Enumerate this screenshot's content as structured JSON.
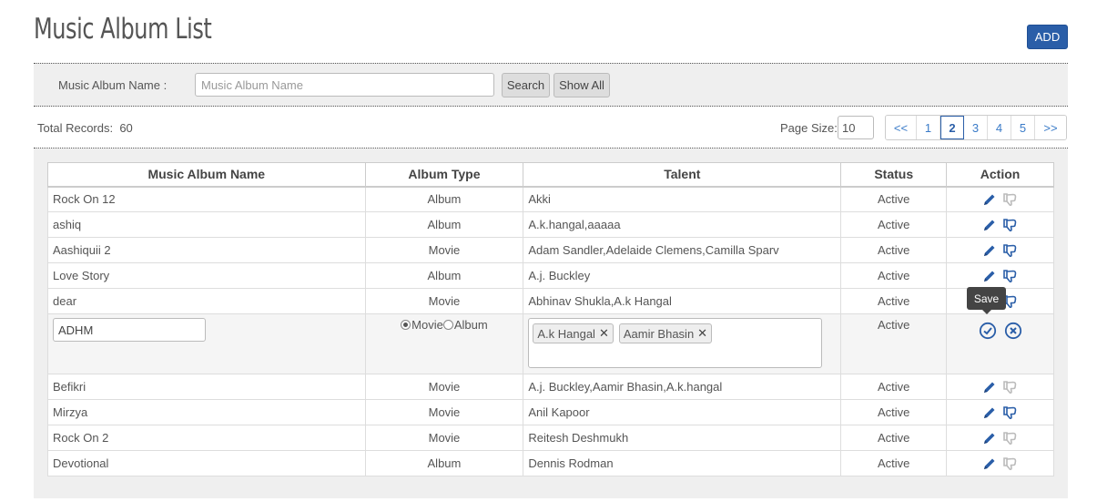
{
  "header": {
    "title": "Music Album List",
    "add_label": "ADD"
  },
  "search": {
    "label": "Music Album Name :",
    "placeholder": "Music Album Name",
    "search_label": "Search",
    "show_all_label": "Show All"
  },
  "records": {
    "total_label": "Total Records:",
    "total_value": "60",
    "page_size_label": "Page Size:",
    "page_size_value": "10"
  },
  "pager": [
    {
      "label": "<<",
      "w": 34
    },
    {
      "label": "1",
      "w": 26
    },
    {
      "label": "2",
      "w": 26
    },
    {
      "label": "3",
      "w": 26
    },
    {
      "label": "4",
      "w": 26
    },
    {
      "label": "5",
      "w": 26
    },
    {
      "label": ">>",
      "w": 34
    }
  ],
  "current_page": "2",
  "table": {
    "headers": [
      "Music Album Name",
      "Album Type",
      "Talent",
      "Status",
      "Action"
    ],
    "rows_before": [
      {
        "name": "Rock On 12",
        "type": "Album",
        "talent": "Akki",
        "status": "Active",
        "like_active": false
      },
      {
        "name": "ashiq",
        "type": "Album",
        "talent": "A.k.hangal,aaaaa",
        "status": "Active",
        "like_active": true
      },
      {
        "name": "Aashiquii 2",
        "type": "Movie",
        "talent": "Adam Sandler,Adelaide Clemens,Camilla Sparv",
        "status": "Active",
        "like_active": true
      },
      {
        "name": "Love Story",
        "type": "Album",
        "talent": "A.j. Buckley",
        "status": "Active",
        "like_active": true
      },
      {
        "name": "dear",
        "type": "Movie",
        "talent": "Abhinav Shukla,A.k Hangal",
        "status": "Active",
        "like_active": true
      }
    ],
    "edit_row": {
      "name_value": "ADHM",
      "radio_movie": "Movie",
      "radio_album": "Album",
      "selected": "Movie",
      "tags": [
        "A.k Hangal",
        "Aamir Bhasin"
      ],
      "status": "Active"
    },
    "rows_after": [
      {
        "name": "Befikri",
        "type": "Movie",
        "talent": "A.j. Buckley,Aamir Bhasin,A.k.hangal",
        "status": "Active",
        "like_active": false
      },
      {
        "name": "Mirzya",
        "type": "Movie",
        "talent": "Anil Kapoor",
        "status": "Active",
        "like_active": true
      },
      {
        "name": "Rock On 2",
        "type": "Movie",
        "talent": "Reitesh Deshmukh",
        "status": "Active",
        "like_active": false
      },
      {
        "name": "Devotional",
        "type": "Album",
        "talent": "Dennis Rodman",
        "status": "Active",
        "like_active": false
      }
    ]
  },
  "tooltip": "Save",
  "colors": {
    "accent": "#2a5ea8",
    "link": "#3a7bc8",
    "panel": "#efefef"
  }
}
